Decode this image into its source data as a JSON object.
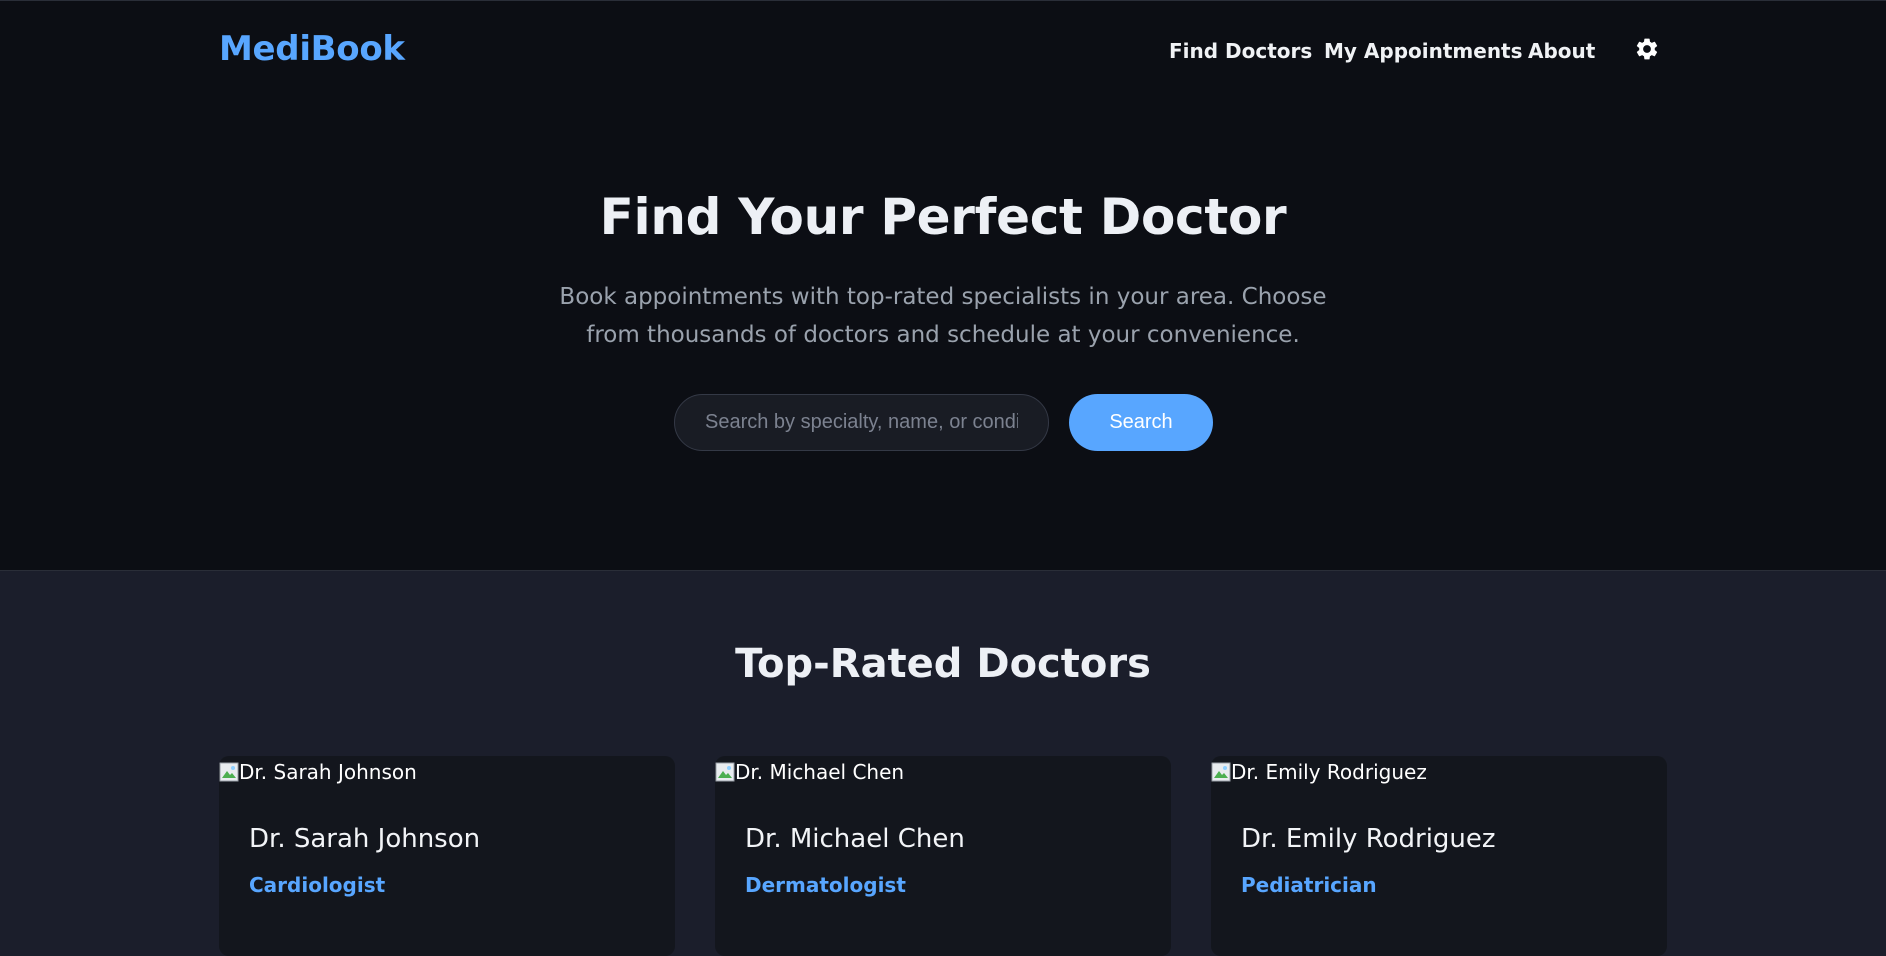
{
  "app": {
    "logo": "MediBook"
  },
  "nav": {
    "find_doctors": "Find Doctors",
    "my_appointments": "My Appointments",
    "about": "About",
    "theme_icon": "gear-icon"
  },
  "hero": {
    "title": "Find Your Perfect Doctor",
    "subtitle": "Book appointments with top-rated specialists in your area. Choose from thousands of doctors and schedule at your convenience.",
    "search_placeholder": "Search by specialty, name, or condition",
    "search_value": "",
    "search_button": "Search"
  },
  "section": {
    "title": "Top-Rated Doctors"
  },
  "doctors": [
    {
      "img_alt": "Dr. Sarah Johnson",
      "name": "Dr. Sarah Johnson",
      "specialty": "Cardiologist"
    },
    {
      "img_alt": "Dr. Michael Chen",
      "name": "Dr. Michael Chen",
      "specialty": "Dermatologist"
    },
    {
      "img_alt": "Dr. Emily Rodriguez",
      "name": "Dr. Emily Rodriguez",
      "specialty": "Pediatrician"
    }
  ],
  "colors": {
    "accent": "#58a6ff",
    "background_dark": "#0c0e14",
    "background_section": "#1b1e2b",
    "card_background": "#13161d"
  }
}
